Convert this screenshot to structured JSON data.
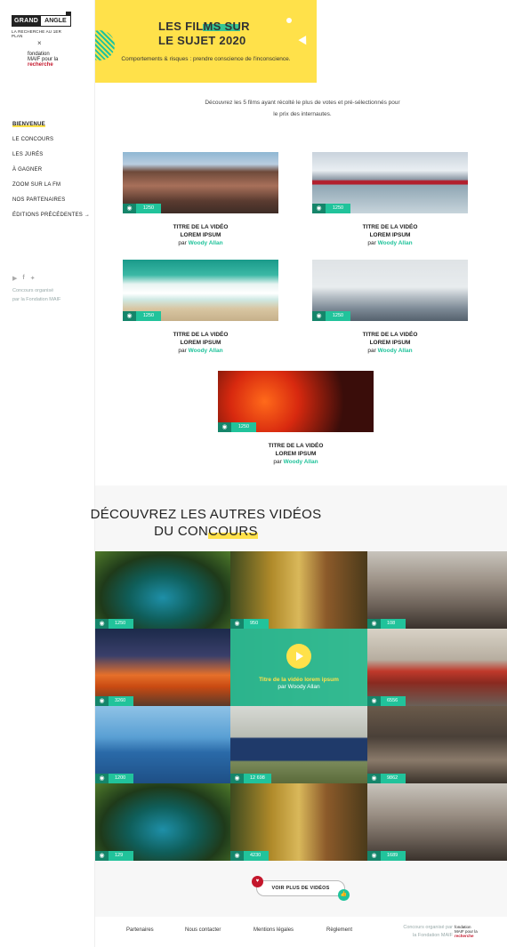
{
  "brand": {
    "logo_left": "GRAND",
    "logo_right": "ANGLE",
    "tagline": "LA RECHERCHE AU 1ER PLAN",
    "cross": "×",
    "fondation_1": "fondation",
    "fondation_2": "MAIF pour la",
    "fondation_3": "recherche"
  },
  "nav": {
    "items": [
      {
        "label": "BIENVENUE",
        "active": true
      },
      {
        "label": "LE CONCOURS"
      },
      {
        "label": "LES JURÉS"
      },
      {
        "label": "À GAGNER"
      },
      {
        "label": "ZOOM SUR LA FM"
      },
      {
        "label": "NOS PARTENAIRES"
      },
      {
        "label": "ÉDITIONS PRÉCÉDENTES →"
      }
    ]
  },
  "social": {
    "icons": [
      "youtube-icon",
      "facebook-icon",
      "twitter-icon"
    ],
    "org_1": "Concours organisé",
    "org_2": "par la Fondation MAIF"
  },
  "hero": {
    "title_1": "LES FILMS SUR",
    "title_2": "LE SUJET 2020",
    "subtitle": "Comportements & risques : prendre conscience de l'inconscience."
  },
  "intro": {
    "line_1": "Découvrez les 5 films ayant récolté le plus de votes et pré-sélectionnés pour",
    "line_2": "le prix des internautes."
  },
  "films": [
    {
      "views": "1250",
      "title_1": "TITRE DE LA VIDÉO",
      "title_2": "LOREM IPSUM",
      "by": "par",
      "author": "Woody Allan"
    },
    {
      "views": "1250",
      "title_1": "TITRE DE LA VIDÉO",
      "title_2": "LOREM IPSUM",
      "by": "par",
      "author": "Woody Allan"
    },
    {
      "views": "1250",
      "title_1": "TITRE DE LA VIDÉO",
      "title_2": "LOREM IPSUM",
      "by": "par",
      "author": "Woody Allan"
    },
    {
      "views": "1250",
      "title_1": "TITRE DE LA VIDÉO",
      "title_2": "LOREM IPSUM",
      "by": "par",
      "author": "Woody Allan"
    },
    {
      "views": "1250",
      "title_1": "TITRE DE LA VIDÉO",
      "title_2": "LOREM IPSUM",
      "by": "par",
      "author": "Woody Allan"
    }
  ],
  "other": {
    "title_1": "DÉCOUVREZ LES AUTRES VIDÉOS",
    "title_2a": "DU CON",
    "title_2b": "COURS"
  },
  "grid": [
    {
      "views": "1250"
    },
    {
      "views": "950"
    },
    {
      "views": "108"
    },
    {
      "views": "3260"
    },
    {
      "views": "",
      "hover_title": "Titre de la vidéo lorem ipsum",
      "hover_author": "par Woody Allan"
    },
    {
      "views": "6556"
    },
    {
      "views": "1200"
    },
    {
      "views": "12 698"
    },
    {
      "views": "9862"
    },
    {
      "views": "129"
    },
    {
      "views": "4230"
    },
    {
      "views": "1689"
    }
  ],
  "more": {
    "label": "VOIR PLUS DE VIDÉOS"
  },
  "footer": {
    "links": [
      "Partenaires",
      "Nous contacter",
      "Mentions légales",
      "Règlement"
    ],
    "org_1": "Concours organisé par",
    "org_2": "la Fondation MAIF",
    "fond_1": "fondation",
    "fond_2": "MAIF pour la",
    "fond_3": "recherche"
  },
  "colors": {
    "accent": "#21c39b",
    "yellow": "#ffe14a",
    "red": "#c4172c"
  }
}
